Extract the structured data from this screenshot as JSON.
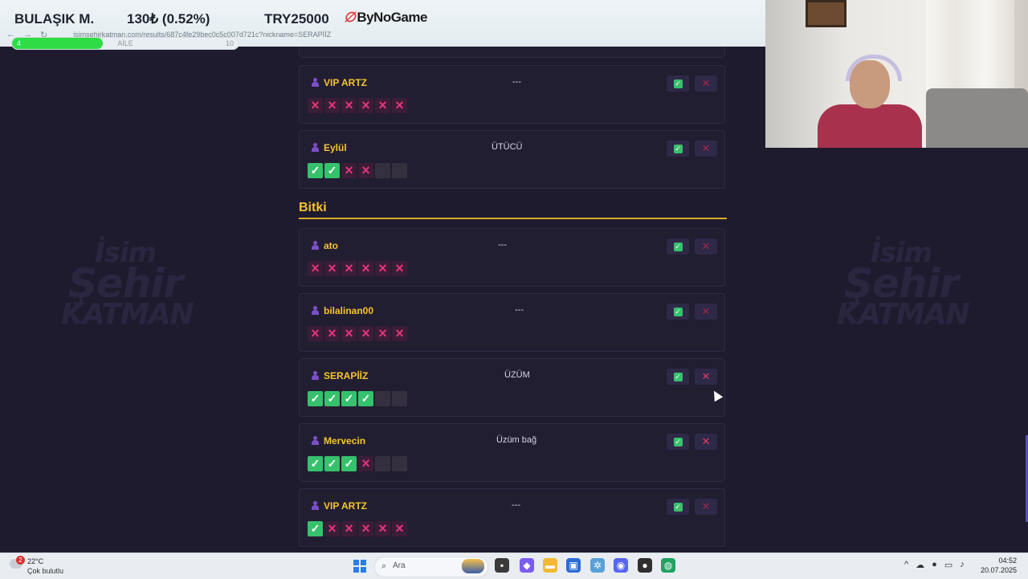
{
  "stream_overlay": {
    "game_name": "BULAŞIK M.",
    "change": "130₺ (0.52%)",
    "prize": "TRY25000",
    "sponsor": "ByNoGame",
    "url": "isimsehirkatman.com/results/687c4fe29bec0c5c007d721c?nickname=SERAPİİZ",
    "progress": {
      "start_label": "4",
      "middle_label": "AİLE",
      "end_label": "10",
      "fraction": 0.4
    }
  },
  "background_logo": {
    "line1": "İsim",
    "line2": "Şehir",
    "line3": "KATMAN"
  },
  "top_cards": [
    {
      "name": "VIP ARTZ",
      "answer": "---",
      "marks": [
        "x",
        "x",
        "x",
        "x",
        "x",
        "x"
      ],
      "reject_active": false
    },
    {
      "name": "Eylül",
      "answer": "ÜTÜCÜ",
      "marks": [
        "c",
        "c",
        "x",
        "x",
        "e",
        "e"
      ],
      "reject_active": false
    }
  ],
  "section": {
    "title": "Bitki"
  },
  "bitki_cards": [
    {
      "name": "ato",
      "answer": "---",
      "marks": [
        "x",
        "x",
        "x",
        "x",
        "x",
        "x"
      ],
      "reject_active": false
    },
    {
      "name": "bilalinan00",
      "answer": "---",
      "marks": [
        "x",
        "x",
        "x",
        "x",
        "x",
        "x"
      ],
      "reject_active": false
    },
    {
      "name": "SERAPİİZ",
      "answer": "ÜZÜM",
      "marks": [
        "c",
        "c",
        "c",
        "c",
        "e",
        "e"
      ],
      "reject_active": true
    },
    {
      "name": "Mervecin",
      "answer": "Üzüm bağ",
      "marks": [
        "c",
        "c",
        "c",
        "x",
        "e",
        "e"
      ],
      "reject_active": true
    },
    {
      "name": "VIP ARTZ",
      "answer": "---",
      "marks": [
        "c",
        "x",
        "x",
        "x",
        "x",
        "x"
      ],
      "reject_active": false
    }
  ],
  "taskbar": {
    "weather_badge": "2",
    "temperature": "22°C",
    "condition": "Çok bulutlu",
    "search_placeholder": "Ara",
    "time": "04:52",
    "date": "20.07.2025"
  },
  "colors": {
    "accent_yellow": "#f4c430",
    "check_green": "#36c26d",
    "reject_pink": "#e2357a",
    "background": "#1f1b2e"
  }
}
